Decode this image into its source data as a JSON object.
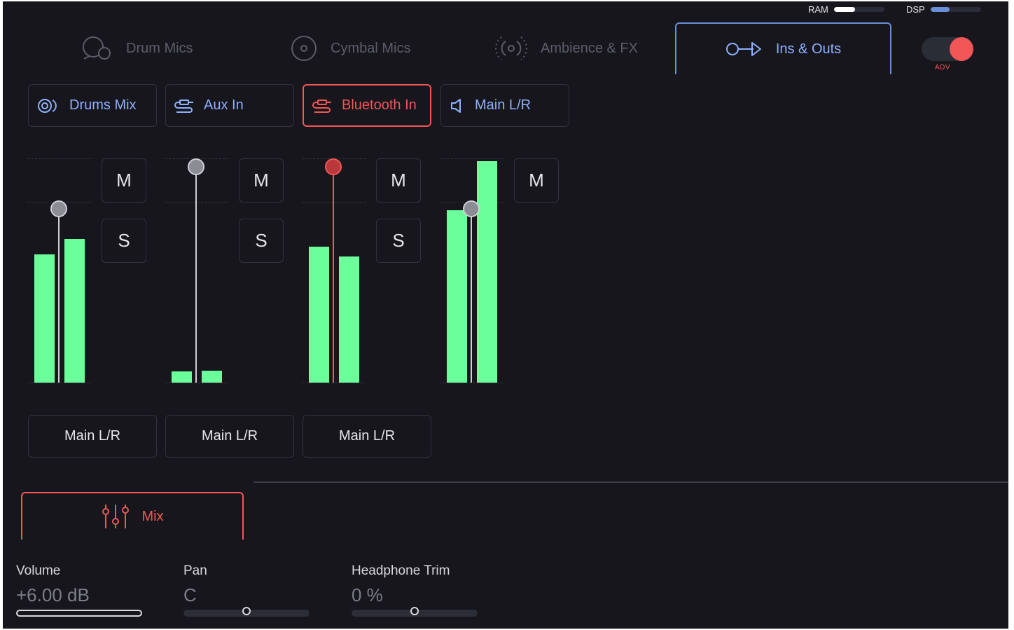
{
  "resources": {
    "ram_label": "RAM",
    "ram_level": 0.42,
    "ram_color": "#ffffff",
    "dsp_label": "DSP",
    "dsp_level": 0.38,
    "dsp_color": "#6b8fd6"
  },
  "top_tabs": [
    {
      "label": "Drum Mics",
      "icon": "drum-mic-icon",
      "active": false
    },
    {
      "label": "Cymbal Mics",
      "icon": "cymbal-icon",
      "active": false
    },
    {
      "label": "Ambience & FX",
      "icon": "ambience-icon",
      "active": false
    },
    {
      "label": "Ins & Outs",
      "icon": "ins-outs-icon",
      "active": true
    }
  ],
  "adv_toggle": {
    "label": "ADV",
    "on": true,
    "color": "#f25656"
  },
  "channel_tabs": [
    {
      "label": "Drums Mix",
      "icon": "drums-mix-icon",
      "active": false
    },
    {
      "label": "Aux In",
      "icon": "cable-icon",
      "active": false
    },
    {
      "label": "Bluetooth In",
      "icon": "cable-icon",
      "active": true
    },
    {
      "label": "Main L/R",
      "icon": "speaker-icon",
      "active": false
    }
  ],
  "strips": [
    {
      "name": "drums-mix",
      "mute_label": "M",
      "solo_label": "S",
      "fader_level": 0.78,
      "meter_left": 0.58,
      "meter_right": 0.65,
      "output_label": "Main L/R",
      "selected": false
    },
    {
      "name": "aux-in",
      "mute_label": "M",
      "solo_label": "S",
      "fader_level": 0.97,
      "meter_left": 0.05,
      "meter_right": 0.055,
      "output_label": "Main L/R",
      "selected": false
    },
    {
      "name": "bluetooth-in",
      "mute_label": "M",
      "solo_label": "S",
      "fader_level": 0.97,
      "meter_left": 0.615,
      "meter_right": 0.57,
      "output_label": "Main L/R",
      "selected": true
    },
    {
      "name": "main-lr",
      "mute_label": "M",
      "solo_label": null,
      "fader_level": 0.78,
      "meter_left": 0.78,
      "meter_right": 1.0,
      "output_label": null,
      "selected": false
    }
  ],
  "colors": {
    "meter": "#6bff9c",
    "accent": "#f25656",
    "blue": "#8fb0ff"
  },
  "mix_tab": {
    "label": "Mix",
    "icon": "mixer-icon"
  },
  "params": {
    "volume": {
      "label": "Volume",
      "value": "+6.00 dB",
      "level": 1.0
    },
    "pan": {
      "label": "Pan",
      "value": "C",
      "level": 0.5
    },
    "headphone_trim": {
      "label": "Headphone Trim",
      "value": "0 %",
      "level": 0.5
    }
  }
}
